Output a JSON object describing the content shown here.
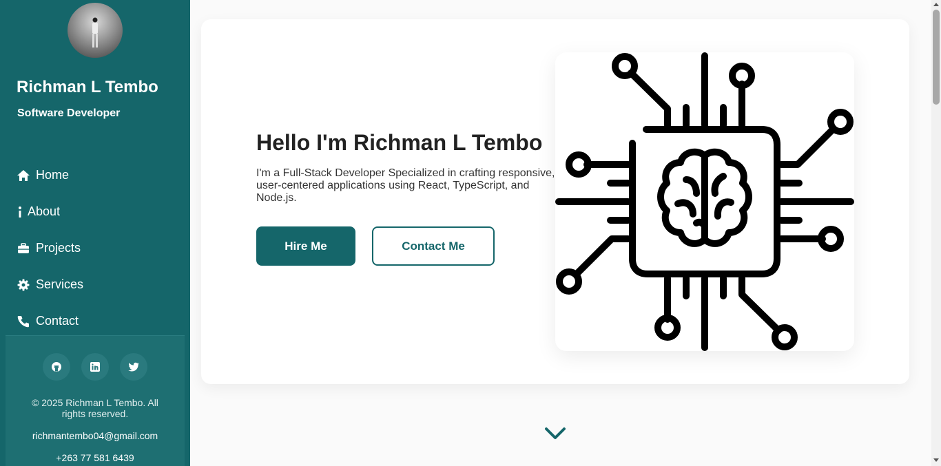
{
  "sidebar": {
    "name": "Richman L Tembo",
    "role": "Software Developer",
    "nav": [
      {
        "label": "Home",
        "icon": "home-icon"
      },
      {
        "label": "About",
        "icon": "info-icon"
      },
      {
        "label": "Projects",
        "icon": "briefcase-icon"
      },
      {
        "label": "Services",
        "icon": "gear-icon"
      },
      {
        "label": "Contact",
        "icon": "phone-icon"
      }
    ],
    "socials": [
      "github-icon",
      "linkedin-icon",
      "twitter-icon"
    ],
    "copyright": "© 2025 Richman L Tembo. All rights reserved.",
    "email": "richmantembo04@gmail.com",
    "phone": "+263 77 581 6439"
  },
  "hero": {
    "title": "Hello I'm Richman L Tembo",
    "description": "I'm a Full-Stack Developer Specialized in crafting responsive, user-centered applications using React, TypeScript, and Node.js.",
    "hire_label": "Hire Me",
    "contact_label": "Contact Me",
    "image_icon": "circuit-brain-icon"
  },
  "colors": {
    "brand": "#15666a",
    "sidebar_footer": "#1e6f72"
  }
}
